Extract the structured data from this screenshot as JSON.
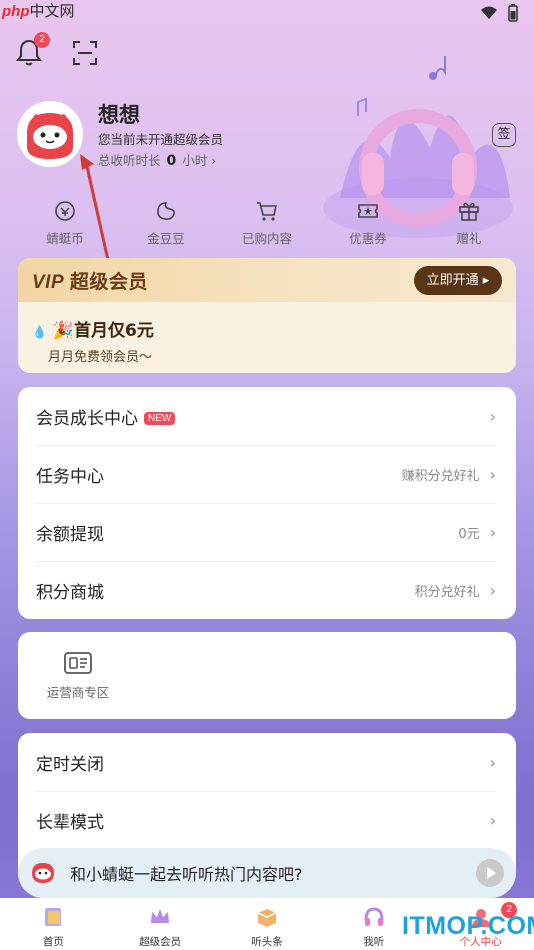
{
  "watermark": {
    "brand": "php",
    "text": "中文网"
  },
  "header": {
    "notification_count": "2"
  },
  "profile": {
    "name": "想想",
    "vip_status": "您当前未开通超级会员",
    "listen_label": "总收听时长",
    "listen_value": "0",
    "listen_unit": "小时",
    "sign_label": "签"
  },
  "quick_links": [
    {
      "label": "蜻蜓币",
      "icon": "coin-icon"
    },
    {
      "label": "金豆豆",
      "icon": "bean-icon"
    },
    {
      "label": "已购内容",
      "icon": "cart-icon"
    },
    {
      "label": "优惠券",
      "icon": "coupon-icon"
    },
    {
      "label": "赠礼",
      "icon": "gift-icon"
    }
  ],
  "vip_card": {
    "title_prefix": "VIP",
    "title": "超级会员",
    "button": "立即开通",
    "promo": "🎉首月仅6元",
    "sub": "月月免费领会员～"
  },
  "menu1": [
    {
      "label": "会员成长中心",
      "badge": "NEW",
      "hint": ""
    },
    {
      "label": "任务中心",
      "hint": "赚积分兑好礼"
    },
    {
      "label": "余额提现",
      "hint": "0元"
    },
    {
      "label": "积分商城",
      "hint": "积分兑好礼"
    }
  ],
  "operator": {
    "label": "运营商专区"
  },
  "menu2": [
    {
      "label": "定时关闭"
    },
    {
      "label": "长辈模式"
    }
  ],
  "ai_bar": {
    "text": "和小蜻蜓一起去听听热门内容吧?"
  },
  "tabs": [
    {
      "label": "首页"
    },
    {
      "label": "超级会员"
    },
    {
      "label": "听头条"
    },
    {
      "label": "我听"
    },
    {
      "label": "个人中心",
      "badge": "2"
    }
  ],
  "site_mark": "ITMOP.COM",
  "colors": {
    "accent": "#e54040",
    "vip_dark": "#5a3515",
    "badge": "#f04a5a"
  }
}
